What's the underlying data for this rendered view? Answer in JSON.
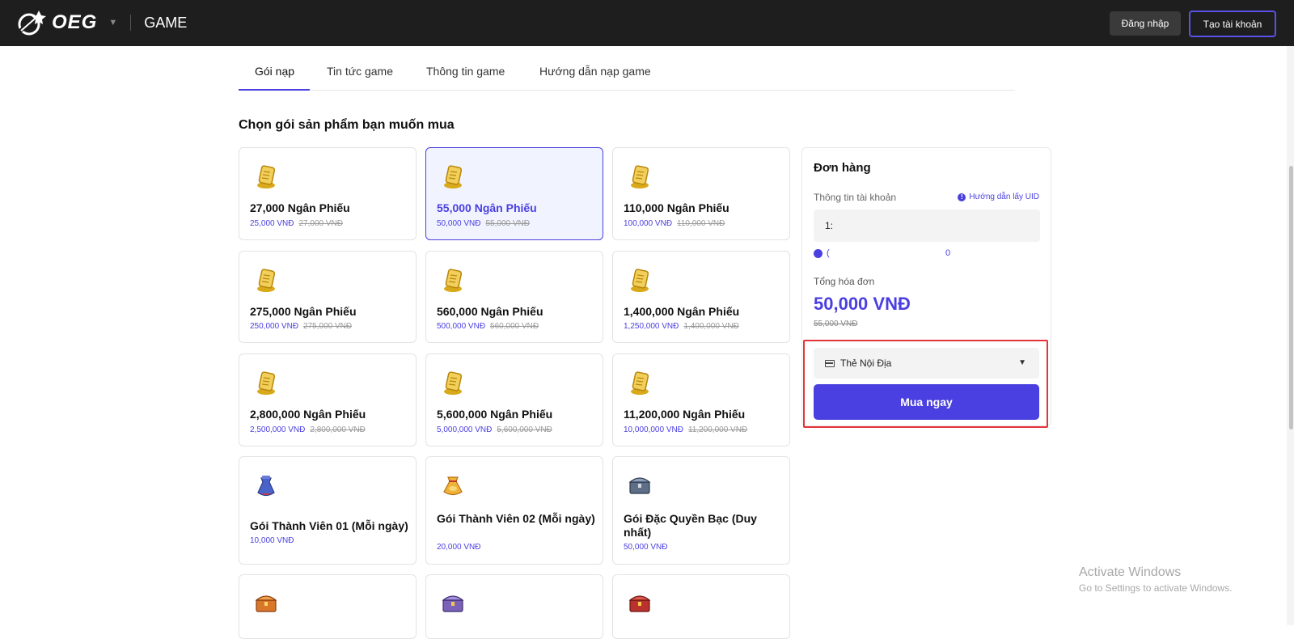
{
  "header": {
    "logo_text": "OEG",
    "caret": "▼",
    "section_label": "GAME",
    "login_label": "Đăng nhập",
    "register_label": "Tạo tài khoản"
  },
  "tabs": [
    {
      "label": "Gói nạp",
      "active": true
    },
    {
      "label": "Tin tức game",
      "active": false
    },
    {
      "label": "Thông tin game",
      "active": false
    },
    {
      "label": "Hướng dẫn nạp game",
      "active": false
    }
  ],
  "section_title": "Chọn gói sản phẩm bạn muốn mua",
  "products": [
    {
      "name": "27,000 Ngân Phiếu",
      "price": "25,000 VNĐ",
      "old_price": "27,000 VNĐ",
      "icon": "scroll-icon"
    },
    {
      "name": "55,000 Ngân Phiếu",
      "price": "50,000 VNĐ",
      "old_price": "55,000 VNĐ",
      "icon": "scroll-icon",
      "selected": true
    },
    {
      "name": "110,000 Ngân Phiếu",
      "price": "100,000 VNĐ",
      "old_price": "110,000 VNĐ",
      "icon": "scroll-icon"
    },
    {
      "name": "275,000 Ngân Phiếu",
      "price": "250,000 VNĐ",
      "old_price": "275,000 VNĐ",
      "icon": "scroll-icon"
    },
    {
      "name": "560,000 Ngân Phiếu",
      "price": "500,000 VNĐ",
      "old_price": "560,000 VNĐ",
      "icon": "scroll-icon"
    },
    {
      "name": "1,400,000 Ngân Phiếu",
      "price": "1,250,000 VNĐ",
      "old_price": "1,400,000 VNĐ",
      "icon": "scroll-icon"
    },
    {
      "name": "2,800,000 Ngân Phiếu",
      "price": "2,500,000 VNĐ",
      "old_price": "2,800,000 VNĐ",
      "icon": "scroll-icon"
    },
    {
      "name": "5,600,000 Ngân Phiếu",
      "price": "5,000,000 VNĐ",
      "old_price": "5,600,000 VNĐ",
      "icon": "scroll-icon"
    },
    {
      "name": "11,200,000 Ngân Phiếu",
      "price": "10,000,000 VNĐ",
      "old_price": "11,200,000 VNĐ",
      "icon": "scroll-icon"
    },
    {
      "name": "Gói Thành Viên 01 (Mỗi ngày)",
      "price": "10,000 VNĐ",
      "icon": "pouch-icon"
    },
    {
      "name": "Gói Thành Viên 02 (Mỗi ngày)",
      "price": "20,000 VNĐ",
      "icon": "gold-pouch-icon"
    },
    {
      "name": "Gói Đặc Quyền Bạc (Duy nhất)",
      "price": "50,000 VNĐ",
      "icon": "silver-chest-icon"
    },
    {
      "name": "",
      "icon": "orange-chest-icon"
    },
    {
      "name": "",
      "icon": "purple-chest-icon"
    },
    {
      "name": "",
      "icon": "red-chest-icon"
    }
  ],
  "order": {
    "title": "Đơn hàng",
    "account_label": "Thông tin tài khoản",
    "uid_help": "Hướng dẫn lấy UID",
    "uid_value": "1:",
    "verified_text": "(",
    "verified_value": "0",
    "total_label": "Tổng hóa đơn",
    "total_value": "50,000 VNĐ",
    "total_old": "55,000 VNĐ",
    "payment_method": "Thẻ Nội Địa",
    "payment_caret": "▼",
    "buy_label": "Mua ngay"
  },
  "watermark": {
    "line1": "Activate Windows",
    "line2": "Go to Settings to activate Windows."
  },
  "colors": {
    "accent": "#4a3fe0",
    "topbar": "#1e1e1e",
    "highlight": "#e4343a"
  }
}
